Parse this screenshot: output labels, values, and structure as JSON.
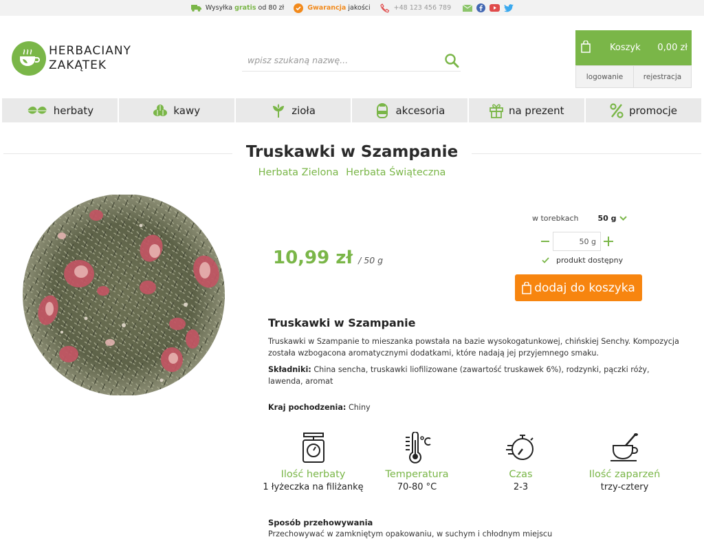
{
  "topbar": {
    "shipping_prefix": "Wysyłka",
    "shipping_highlight": "gratis",
    "shipping_suffix": "od 80 zł",
    "guarantee_highlight": "Gwarancja",
    "guarantee_suffix": "jakości",
    "phone": "+48 123 456 789"
  },
  "logo": {
    "line1": "HERBACIANY",
    "line2": "ZAKĄTEK"
  },
  "search": {
    "placeholder": "wpisz szukaną nazwę..."
  },
  "cart": {
    "label": "Koszyk",
    "total": "0,00 zł"
  },
  "auth": {
    "login": "logowanie",
    "register": "rejestracja"
  },
  "nav": [
    {
      "label": "herbaty"
    },
    {
      "label": "kawy"
    },
    {
      "label": "zioła"
    },
    {
      "label": "akcesoria"
    },
    {
      "label": "na prezent"
    },
    {
      "label": "promocje"
    }
  ],
  "product": {
    "title": "Truskawki w Szampanie",
    "categories": [
      "Herbata Zielona",
      "Herbata Świąteczna"
    ],
    "price": "10,99 zł",
    "price_unit": "/ 50 g",
    "variant_label": "w torebkach",
    "variant_value": "50 g",
    "quantity": "50 g",
    "availability": "produkt dostępny",
    "add_to_cart": "dodaj do koszyka",
    "desc_title": "Truskawki w Szampanie",
    "description": "Truskawki w Szampanie to mieszanka powstała na bazie wysokogatunkowej, chińskiej Senchy. Kompozycja została wzbogacona aromatycznymi dodatkami, które nadają jej przyjemnego smaku.",
    "ingredients_label": "Składniki:",
    "ingredients": "China sencha, truskawki liofilizowane (zawartość truskawek 6%), rodzynki, pączki róży, lawenda, aromat",
    "origin_label": "Kraj pochodzenia:",
    "origin": "Chiny"
  },
  "brewing": [
    {
      "icon": "scale-icon",
      "label": "Ilość herbaty",
      "value": "1 łyżeczka na filiżankę"
    },
    {
      "icon": "thermometer-icon",
      "label": "Temperatura",
      "value": "70-80 °C"
    },
    {
      "icon": "stopwatch-icon",
      "label": "Czas",
      "value": "2-3"
    },
    {
      "icon": "teacup-icon",
      "label": "Ilość zaparzeń",
      "value": "trzy-cztery"
    }
  ],
  "storage": {
    "title": "Sposób przehowywania",
    "text": "Przechowywać w zamkniętym opakowaniu, w suchym i chłodnym miejscu"
  },
  "colors": {
    "accent": "#7ab648",
    "cta": "#f7850f",
    "nav_bg": "#e9e9e9"
  }
}
